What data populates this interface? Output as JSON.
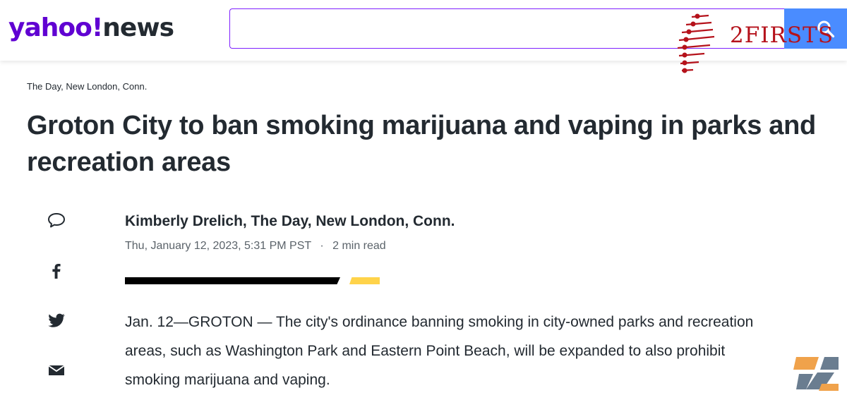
{
  "header": {
    "logo_brand": "yahoo!",
    "logo_section": "news",
    "search": {
      "value": "",
      "placeholder": ""
    }
  },
  "watermark": {
    "text": "2FIRSTS"
  },
  "article": {
    "source": "The Day, New London, Conn.",
    "headline": "Groton City to ban smoking marijuana and vaping in parks and recreation areas",
    "byline": "Kimberly Drelich, The Day, New London, Conn.",
    "date": "Thu, January 12, 2023, 5:31 PM PST",
    "separator": "·",
    "read_time": "2 min read",
    "body": "Jan. 12—GROTON — The city's ordinance banning smoking in city-owned parks and recreation areas, such as Washington Park and Eastern Point Beach, will be expanded to also prohibit smoking marijuana and vaping."
  },
  "share_icons": [
    "comment-icon",
    "facebook-icon",
    "twitter-icon",
    "mail-icon"
  ],
  "colors": {
    "brand_purple": "#6001d2",
    "search_blue": "#4a8cff",
    "accent_yellow": "#ffd34a",
    "watermark_red": "#b5121b"
  }
}
